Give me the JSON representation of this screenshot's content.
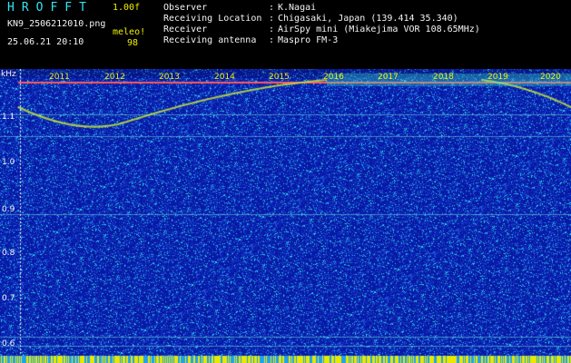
{
  "header": {
    "app_title": "HROFFT",
    "version": "1.00f",
    "filename": "KN9_2506212010.png",
    "mode": "meleo!",
    "count": "98",
    "datetime": "25.06.21 20:10",
    "fields": [
      {
        "label": "Observer",
        "value": "K.Nagai"
      },
      {
        "label": "Receiving Location",
        "value": "Chigasaki, Japan (139.414 35.340)"
      },
      {
        "label": "Receiver",
        "value": "AirSpy mini (Miakejima VOR 108.65MHz)"
      },
      {
        "label": "Receiving antenna",
        "value": "Maspro FM-3"
      }
    ],
    "separator": ":"
  },
  "chart_data": {
    "type": "heatmap",
    "y_unit": "kHz",
    "y_ticks": [
      "1.1",
      "1.0",
      "0.9",
      "0.8",
      "0.7",
      "0.6"
    ],
    "x_ticks": [
      "2011",
      "2012",
      "2013",
      "2014",
      "2015",
      "2016",
      "2017",
      "2018",
      "2019",
      "2020"
    ],
    "colors": {
      "background": "#0a1a9c",
      "noise_hot": "#3ef0f0",
      "trace": "#f0f000",
      "line": "#ff5a5a"
    }
  }
}
